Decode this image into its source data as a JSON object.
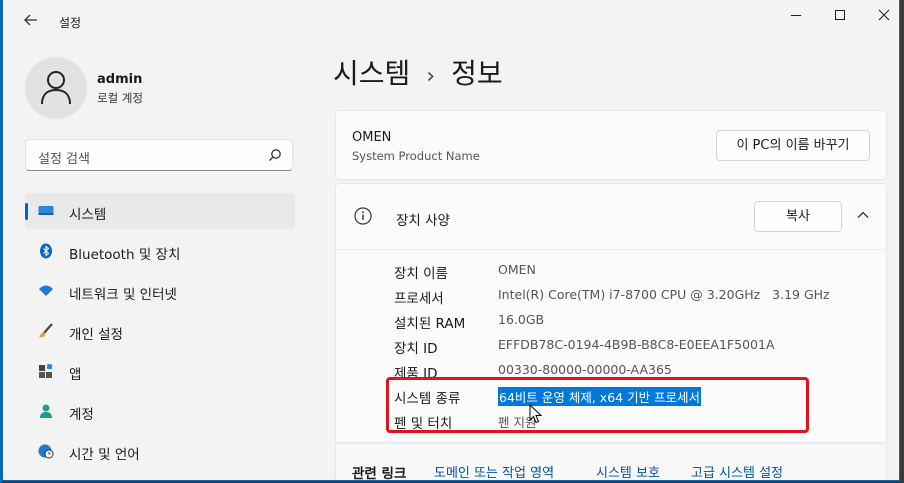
{
  "app": {
    "title": "설정"
  },
  "user": {
    "name": "admin",
    "type": "로컬 계정"
  },
  "search": {
    "placeholder": "설정 검색"
  },
  "nav": {
    "items": [
      {
        "label": "시스템",
        "icon": "system-icon"
      },
      {
        "label": "Bluetooth 및 장치",
        "icon": "bluetooth-icon"
      },
      {
        "label": "네트워크 및 인터넷",
        "icon": "wifi-icon"
      },
      {
        "label": "개인 설정",
        "icon": "brush-icon"
      },
      {
        "label": "앱",
        "icon": "apps-icon"
      },
      {
        "label": "계정",
        "icon": "account-icon"
      },
      {
        "label": "시간 및 언어",
        "icon": "clock-globe-icon"
      }
    ]
  },
  "breadcrumb": {
    "parent": "시스템",
    "separator": "›",
    "current": "정보"
  },
  "device": {
    "name": "OMEN",
    "subtitle": "System Product Name",
    "rename_label": "이 PC의 이름 바꾸기"
  },
  "specs": {
    "title": "장치 사양",
    "copy_label": "복사",
    "rows": [
      {
        "key": "장치 이름",
        "value": "OMEN"
      },
      {
        "key": "프로세서",
        "value": "Intel(R) Core(TM) i7-8700 CPU @ 3.20GHz   3.19 GHz"
      },
      {
        "key": "설치된 RAM",
        "value": "16.0GB"
      },
      {
        "key": "장치 ID",
        "value": "EFFDB78C-0194-4B9B-B8C8-E0EEA1F5001A"
      },
      {
        "key": "제품 ID",
        "value": "00330-80000-00000-AA365"
      },
      {
        "key": "시스템 종류",
        "value": "64비트 운영 체제, x64 기반 프로세서"
      },
      {
        "key": "펜 및 터치",
        "value": "펜 지원"
      }
    ]
  },
  "related": {
    "label": "관련 링크",
    "links": [
      "도메인 또는 작업 영역",
      "시스템 보호",
      "고급 시스템 설정"
    ]
  },
  "colors": {
    "accent": "#0067c0",
    "highlight_border": "#e0131b",
    "selection": "#0078d7"
  }
}
